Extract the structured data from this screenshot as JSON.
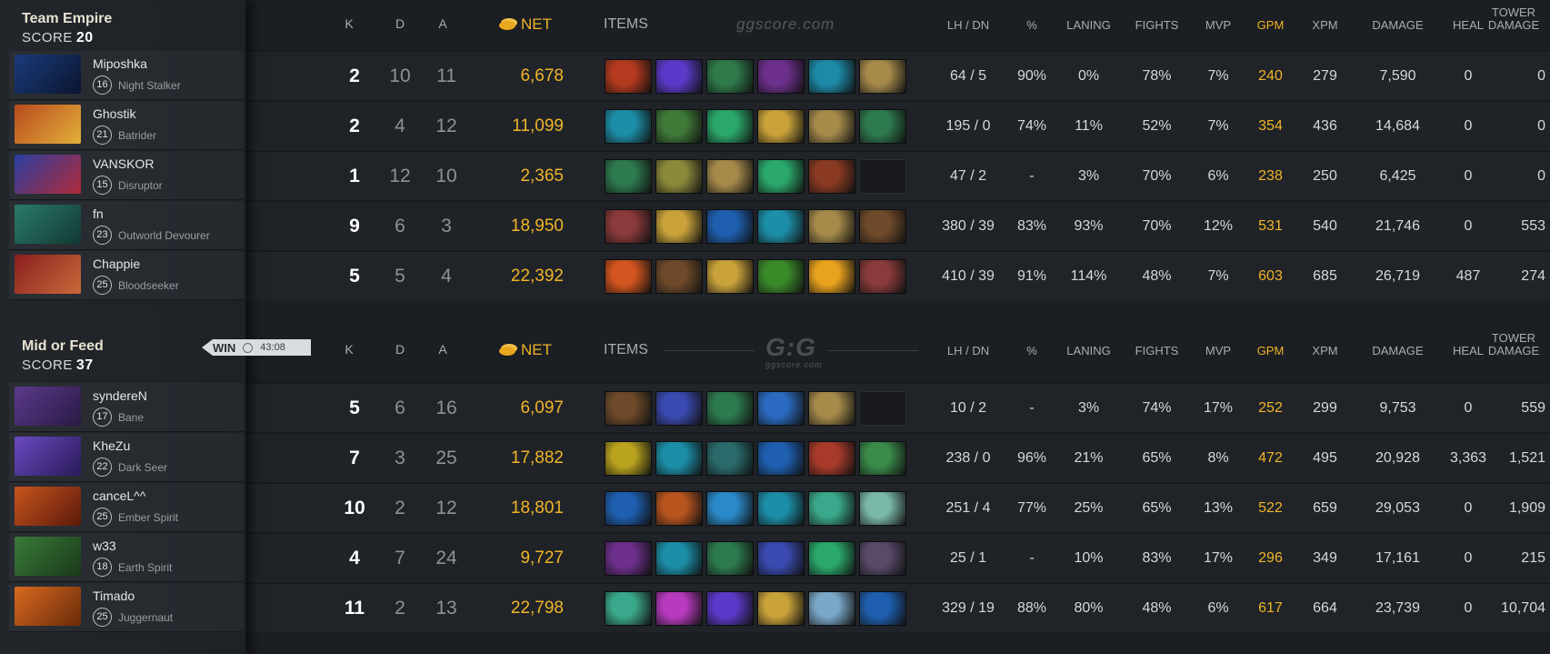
{
  "teams": [
    {
      "name": "Team Empire",
      "score_label": "SCORE",
      "score": "20",
      "players": [
        {
          "name": "Miposhka",
          "level": "16",
          "hero": "Night Stalker",
          "k": "2",
          "d": "10",
          "a": "11",
          "net": "6,678",
          "lhdn": "64 / 5",
          "pct": "90%",
          "laning": "0%",
          "fights": "78%",
          "mvp": "7%",
          "gpm": "240",
          "xpm": "279",
          "damage": "7,590",
          "heal": "0",
          "tower": "0",
          "portrait": [
            "#1b3b7a",
            "#0a1530"
          ],
          "items": [
            "#b33a1e",
            "#5b3ac9",
            "#2f7a4a",
            "#6d2f8c",
            "#1d8aa8",
            "#a58a4a"
          ]
        },
        {
          "name": "Ghostik",
          "level": "21",
          "hero": "Batrider",
          "k": "2",
          "d": "4",
          "a": "12",
          "net": "11,099",
          "lhdn": "195 / 0",
          "pct": "74%",
          "laning": "11%",
          "fights": "52%",
          "mvp": "7%",
          "gpm": "354",
          "xpm": "436",
          "damage": "14,684",
          "heal": "0",
          "tower": "0",
          "portrait": [
            "#b84a1e",
            "#e3b03a"
          ],
          "items": [
            "#1c8ea8",
            "#3f7a38",
            "#2aa86a",
            "#c9a23a",
            "#a58a4a",
            "#2d7a4e"
          ]
        },
        {
          "name": "VANSKOR",
          "level": "15",
          "hero": "Disruptor",
          "k": "1",
          "d": "12",
          "a": "10",
          "net": "2,365",
          "lhdn": "47 / 2",
          "pct": "-",
          "laning": "3%",
          "fights": "70%",
          "mvp": "6%",
          "gpm": "238",
          "xpm": "250",
          "damage": "6,425",
          "heal": "0",
          "tower": "0",
          "portrait": [
            "#2a3fa0",
            "#b02a3a"
          ],
          "items": [
            "#2d7a4e",
            "#8c8a3a",
            "#a58a4a",
            "#2aa86a",
            "#8a3a22",
            "empty"
          ]
        },
        {
          "name": "fn",
          "level": "23",
          "hero": "Outworld Devourer",
          "k": "9",
          "d": "6",
          "a": "3",
          "net": "18,950",
          "lhdn": "380 / 39",
          "pct": "83%",
          "laning": "93%",
          "fights": "70%",
          "mvp": "12%",
          "gpm": "531",
          "xpm": "540",
          "damage": "21,746",
          "heal": "0",
          "tower": "553",
          "portrait": [
            "#2a7a6a",
            "#123a34"
          ],
          "items": [
            "#8a3a3a",
            "#c9a23a",
            "#1e5fb0",
            "#1c8ea8",
            "#a58a4a",
            "#6e4a2a"
          ]
        },
        {
          "name": "Chappie",
          "level": "25",
          "hero": "Bloodseeker",
          "k": "5",
          "d": "5",
          "a": "4",
          "net": "22,392",
          "lhdn": "410 / 39",
          "pct": "91%",
          "laning": "114%",
          "fights": "48%",
          "mvp": "7%",
          "gpm": "603",
          "xpm": "685",
          "damage": "26,719",
          "heal": "487",
          "tower": "274",
          "portrait": [
            "#8a1e1e",
            "#c96a3a"
          ],
          "items": [
            "#d2541e",
            "#6e4a2a",
            "#c9a23a",
            "#3a8a2a",
            "#e8a21e",
            "#8a3a3a"
          ]
        }
      ]
    },
    {
      "name": "Mid or Feed",
      "score_label": "SCORE",
      "score": "37",
      "win_label": "WIN",
      "win_time": "43:08",
      "players": [
        {
          "name": "syndereN",
          "level": "17",
          "hero": "Bane",
          "k": "5",
          "d": "6",
          "a": "16",
          "net": "6,097",
          "lhdn": "10 / 2",
          "pct": "-",
          "laning": "3%",
          "fights": "74%",
          "mvp": "17%",
          "gpm": "252",
          "xpm": "299",
          "damage": "9,753",
          "heal": "0",
          "tower": "559",
          "portrait": [
            "#5a3a8a",
            "#2a1a44"
          ],
          "items": [
            "#6e4a2a",
            "#3a4ab0",
            "#2d7a4e",
            "#2a6ac0",
            "#a58a4a",
            "empty"
          ]
        },
        {
          "name": "KheZu",
          "level": "22",
          "hero": "Dark Seer",
          "k": "7",
          "d": "3",
          "a": "25",
          "net": "17,882",
          "lhdn": "238 / 0",
          "pct": "96%",
          "laning": "21%",
          "fights": "65%",
          "mvp": "8%",
          "gpm": "472",
          "xpm": "495",
          "damage": "20,928",
          "heal": "3,363",
          "tower": "1,521",
          "portrait": [
            "#6a4ac0",
            "#2a1a5a"
          ],
          "items": [
            "#b8a21e",
            "#1c8ea8",
            "#2a6a6a",
            "#1e5fb0",
            "#a83a2a",
            "#3a8a4a"
          ]
        },
        {
          "name": "canceL^^",
          "level": "25",
          "hero": "Ember Spirit",
          "k": "10",
          "d": "2",
          "a": "12",
          "net": "18,801",
          "lhdn": "251 / 4",
          "pct": "77%",
          "laning": "25%",
          "fights": "65%",
          "mvp": "13%",
          "gpm": "522",
          "xpm": "659",
          "damage": "29,053",
          "heal": "0",
          "tower": "1,909",
          "portrait": [
            "#c9541e",
            "#5a1a0a"
          ],
          "items": [
            "#1e5fb0",
            "#b8541e",
            "#2a8ac9",
            "#1c8ea8",
            "#3aa88a",
            "#7ab8a8"
          ]
        },
        {
          "name": "w33",
          "level": "18",
          "hero": "Earth Spirit",
          "k": "4",
          "d": "7",
          "a": "24",
          "net": "9,727",
          "lhdn": "25 / 1",
          "pct": "-",
          "laning": "10%",
          "fights": "83%",
          "mvp": "17%",
          "gpm": "296",
          "xpm": "349",
          "damage": "17,161",
          "heal": "0",
          "tower": "215",
          "portrait": [
            "#3a7a3a",
            "#1a3a1a"
          ],
          "items": [
            "#6d2f8c",
            "#1c8ea8",
            "#2d7a4e",
            "#3a4ab0",
            "#2aa86a",
            "#5a4a6a"
          ]
        },
        {
          "name": "Timado",
          "level": "25",
          "hero": "Juggernaut",
          "k": "11",
          "d": "2",
          "a": "13",
          "net": "22,798",
          "lhdn": "329 / 19",
          "pct": "88%",
          "laning": "80%",
          "fights": "48%",
          "mvp": "6%",
          "gpm": "617",
          "xpm": "664",
          "damage": "23,739",
          "heal": "0",
          "tower": "10,704",
          "portrait": [
            "#d86a1e",
            "#6a2a0a"
          ],
          "items": [
            "#3aa88a",
            "#b83ac0",
            "#5b3ac9",
            "#c9a23a",
            "#7aa8c8",
            "#1e5fb0"
          ]
        }
      ]
    }
  ],
  "headers": {
    "k": "K",
    "d": "D",
    "a": "A",
    "net": "NET",
    "items": "ITEMS",
    "lhdn": "LH  /  DN",
    "pct": "%",
    "laning": "LANING",
    "fights": "FIGHTS",
    "mvp": "MVP",
    "gpm": "GPM",
    "xpm": "XPM",
    "damage": "DAMAGE",
    "heal": "HEAL",
    "tower1": "TOWER",
    "tower2": "DAMAGE"
  },
  "logos": {
    "top": "ggscore.com",
    "mid": "G:G",
    "mid_sub": "ggscore.com"
  },
  "icons": {
    "net": "gold-coins-icon",
    "clock": "clock-icon"
  }
}
